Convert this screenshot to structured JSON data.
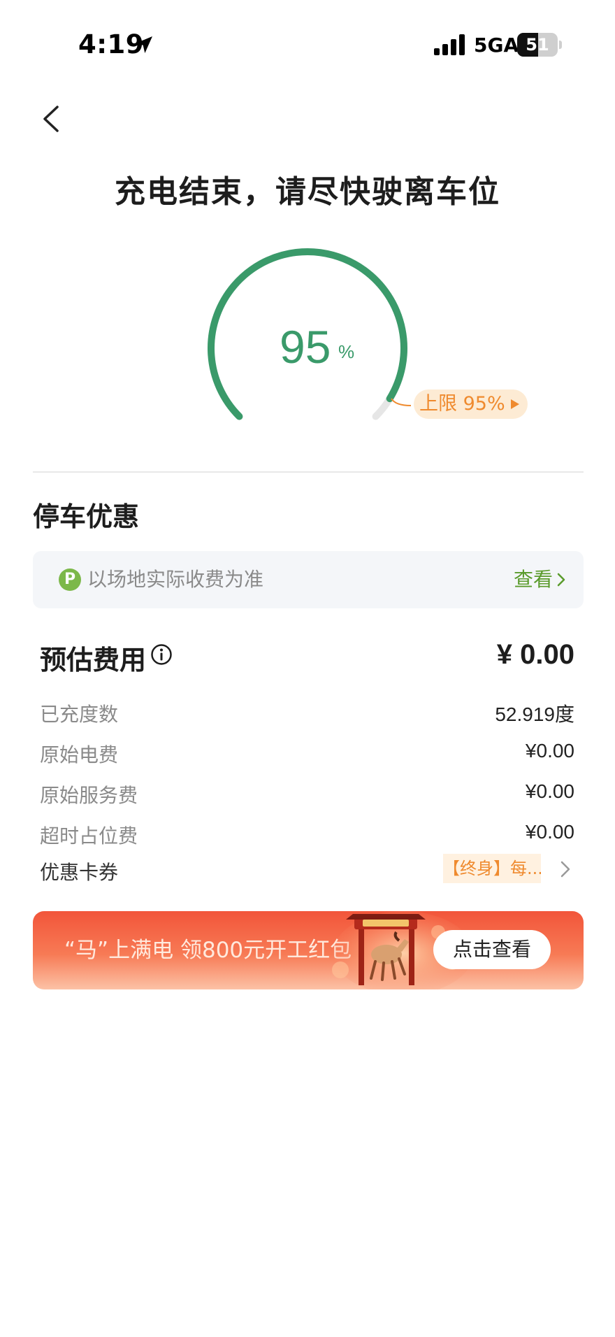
{
  "status_bar": {
    "time": "4:19",
    "network": "5GA",
    "battery": "51",
    "battery_level": 0.51
  },
  "header": {
    "title": "充电结束，请尽快驶离车位"
  },
  "gauge": {
    "value": "95",
    "unit": "%",
    "level": 0.95,
    "limit_label": "上限 95%",
    "color": "#3a9a6a"
  },
  "parking": {
    "section_title": "停车优惠",
    "icon_letter": "P",
    "notice": "以场地实际收费为准",
    "view_label": "查看"
  },
  "fees": {
    "title": "预估费用",
    "total": "¥ 0.00",
    "rows": [
      {
        "label": "已充度数",
        "value": "52.919度"
      },
      {
        "label": "原始电费",
        "value": "¥0.00"
      },
      {
        "label": "原始服务费",
        "value": "¥0.00"
      },
      {
        "label": "超时占位费",
        "value": "¥0.00"
      }
    ],
    "coupon_label": "优惠卡券",
    "coupon_tag": "【终身】每..."
  },
  "promo": {
    "text": "“马”上满电 领800元开工红包",
    "button": "点击查看"
  }
}
